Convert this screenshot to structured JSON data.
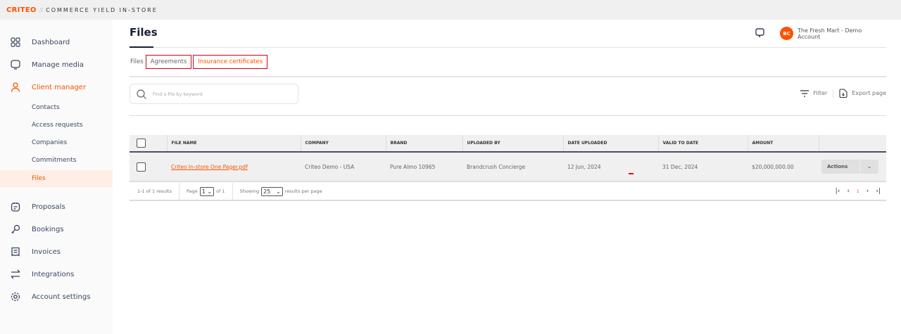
{
  "app": {
    "logo": "CRITEO",
    "separator": "//",
    "product": "COMMERCE YIELD IN-STORE"
  },
  "sidebar": {
    "items": [
      {
        "label": "Dashboard",
        "icon": "grid-icon"
      },
      {
        "label": "Manage media",
        "icon": "monitor-icon"
      },
      {
        "label": "Client manager",
        "icon": "user-icon"
      },
      {
        "label": "Proposals",
        "icon": "clipboard-icon"
      },
      {
        "label": "Bookings",
        "icon": "key-icon"
      },
      {
        "label": "Invoices",
        "icon": "receipt-icon"
      },
      {
        "label": "Integrations",
        "icon": "arrows-icon"
      },
      {
        "label": "Account settings",
        "icon": "gear-icon"
      }
    ],
    "subitems": [
      "Contacts",
      "Access requests",
      "Companies",
      "Commitments",
      "Files"
    ]
  },
  "header": {
    "title": "Files",
    "account": "The Fresh Mart - Demo Account",
    "avatar": "BC"
  },
  "tabs": [
    "Files",
    "Agreements",
    "Insurance certificates"
  ],
  "search": {
    "placeholder": "Find a file by keyword"
  },
  "toolbar": {
    "filter": "Filter",
    "export": "Export page"
  },
  "table": {
    "columns": [
      "FILE NAME",
      "COMPANY",
      "BRAND",
      "UPLOADED BY",
      "DATE UPLOADED",
      "VALID TO DATE",
      "AMOUNT"
    ],
    "rows": [
      {
        "file_name": "Criteo In-store One Pager.pdf",
        "company": "Criteo Demo - USA",
        "brand": "Pure Almo 10965",
        "uploaded_by": "Brandcrush Concierge",
        "date_uploaded": "12 Jun, 2024",
        "valid_to": "31 Dec, 2024",
        "amount": "$20,000,000.00",
        "actions": "Actions"
      }
    ]
  },
  "pager": {
    "results": "1-1 of 1 results",
    "page_label": "Page",
    "page": "1",
    "of": "of 1",
    "showing": "Showing",
    "per_page": "25",
    "per_page_suffix": "results per page",
    "current": "1"
  },
  "colors": {
    "accent": "#fe5000"
  }
}
